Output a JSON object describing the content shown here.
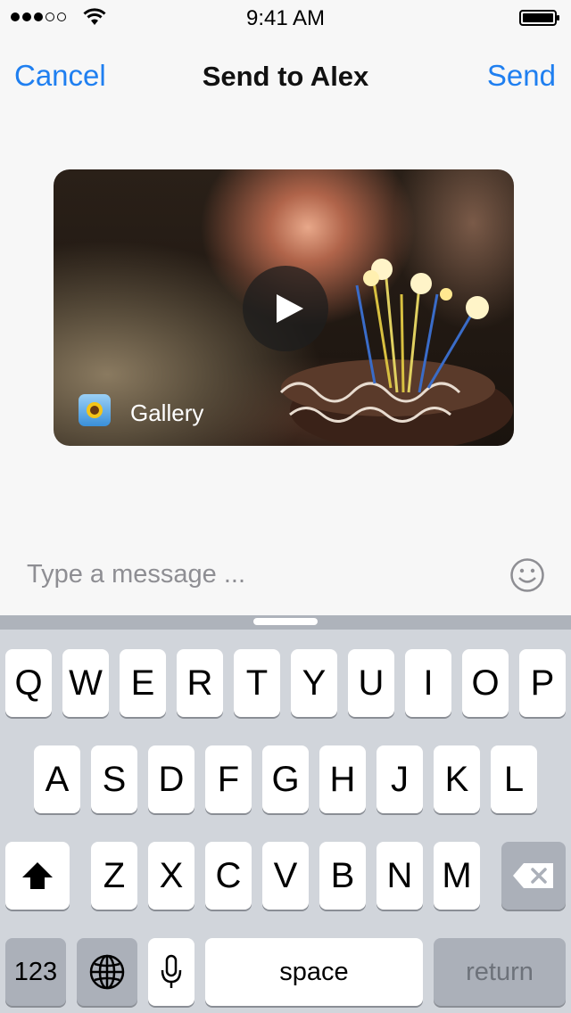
{
  "status_bar": {
    "time": "9:41 AM",
    "signal_filled": 3,
    "signal_total": 5,
    "wifi_icon": "wifi-icon",
    "battery_icon": "battery-icon"
  },
  "nav": {
    "cancel_label": "Cancel",
    "title": "Send to Alex",
    "send_label": "Send"
  },
  "media": {
    "source_label": "Gallery",
    "play_icon": "play-icon",
    "source_icon": "gallery-app-icon"
  },
  "message": {
    "placeholder": "Type a message ...",
    "emoji_icon": "smiley-icon"
  },
  "keyboard": {
    "row1": [
      "Q",
      "W",
      "E",
      "R",
      "T",
      "Y",
      "U",
      "I",
      "O",
      "P"
    ],
    "row2": [
      "A",
      "S",
      "D",
      "F",
      "G",
      "H",
      "J",
      "K",
      "L"
    ],
    "row3": [
      "Z",
      "X",
      "C",
      "V",
      "B",
      "N",
      "M"
    ],
    "numbers_label": "123",
    "space_label": "space",
    "return_label": "return",
    "shift_icon": "shift-icon",
    "delete_icon": "delete-icon",
    "globe_icon": "globe-icon",
    "mic_icon": "microphone-icon"
  },
  "colors": {
    "accent": "#1f7ff0",
    "keyboard_bg": "#d1d5db",
    "key": "#ffffff",
    "key_dark": "#abb0b9",
    "placeholder": "#8e8e93"
  }
}
